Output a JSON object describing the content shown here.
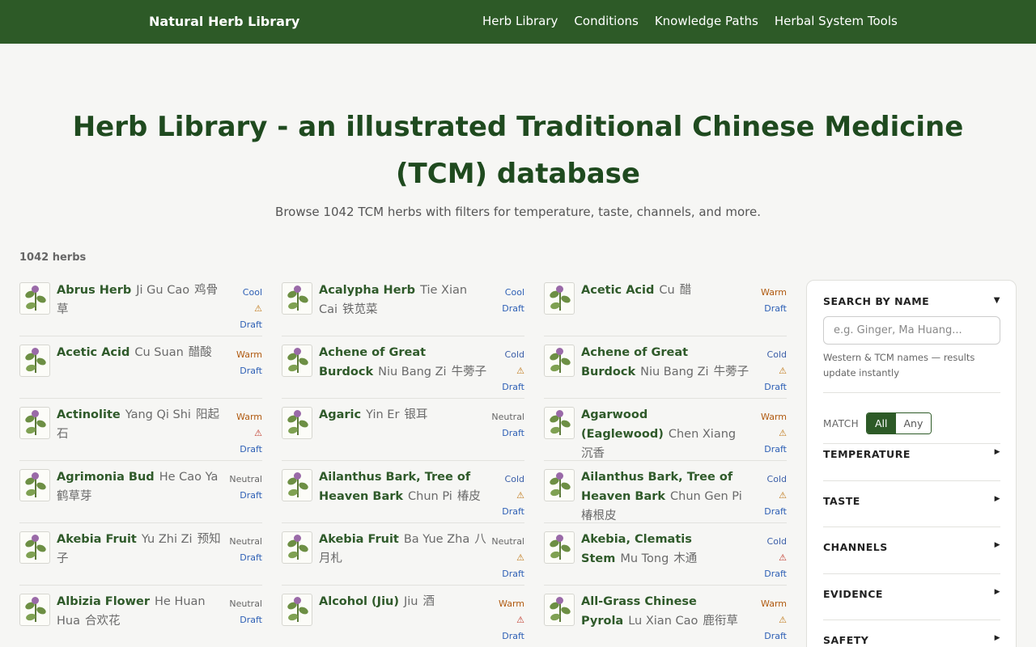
{
  "header": {
    "brand": "Natural Herb Library",
    "nav": [
      "Herb Library",
      "Conditions",
      "Knowledge Paths",
      "Herbal System Tools"
    ]
  },
  "hero": {
    "title": "Herb Library - an illustrated Traditional Chinese Medicine (TCM) database",
    "subtitle": "Browse 1042 TCM herbs with filters for temperature, taste, channels, and more."
  },
  "count_label": "1042 herbs",
  "herbs": [
    {
      "en": "Abrus Herb",
      "pinyin": "Ji Gu Cao",
      "zh": "鸡骨草",
      "temp": "Cool",
      "temp_class": "cool",
      "warning": "⚠",
      "warn_class": "warn",
      "status": "Draft"
    },
    {
      "en": "Acalypha Herb",
      "pinyin": "Tie Xian Cai",
      "zh": "铁苋菜",
      "temp": "Cool",
      "temp_class": "cool",
      "warning": "",
      "warn_class": "warn",
      "status": "Draft"
    },
    {
      "en": "Acetic Acid",
      "pinyin": "Cu",
      "zh": "醋",
      "temp": "Warm",
      "temp_class": "warm",
      "warning": "",
      "warn_class": "warn",
      "status": "Draft"
    },
    {
      "en": "Acetic Acid",
      "pinyin": "Cu Suan",
      "zh": "醋酸",
      "temp": "Warm",
      "temp_class": "warm",
      "warning": "",
      "warn_class": "warn",
      "status": "Draft"
    },
    {
      "en": "Achene of Great Burdock",
      "pinyin": "Niu Bang Zi",
      "zh": "牛蒡子",
      "temp": "Cold",
      "temp_class": "cold",
      "warning": "⚠",
      "warn_class": "warn",
      "status": "Draft"
    },
    {
      "en": "Achene of Great Burdock",
      "pinyin": "Niu Bang Zi",
      "zh": "牛蒡子",
      "temp": "Cold",
      "temp_class": "cold",
      "warning": "⚠",
      "warn_class": "warn",
      "status": "Draft"
    },
    {
      "en": "Actinolite",
      "pinyin": "Yang Qi Shi",
      "zh": "阳起石",
      "temp": "Warm",
      "temp_class": "warm",
      "warning": "⚠",
      "warn_class": "warn red",
      "status": "Draft"
    },
    {
      "en": "Agaric",
      "pinyin": "Yin Er",
      "zh": "银耳",
      "temp": "Neutral",
      "temp_class": "neutral",
      "warning": "",
      "warn_class": "warn",
      "status": "Draft"
    },
    {
      "en": "Agarwood (Eaglewood)",
      "pinyin": "Chen Xiang",
      "zh": "沉香",
      "temp": "Warm",
      "temp_class": "warm",
      "warning": "⚠",
      "warn_class": "warn",
      "status": "Draft"
    },
    {
      "en": "Agrimonia Bud",
      "pinyin": "He Cao Ya",
      "zh": "鹤草芽",
      "temp": "Neutral",
      "temp_class": "neutral",
      "warning": "",
      "warn_class": "warn",
      "status": "Draft"
    },
    {
      "en": "Ailanthus Bark, Tree of Heaven Bark",
      "pinyin": "Chun Pi",
      "zh": "椿皮",
      "temp": "Cold",
      "temp_class": "cold",
      "warning": "⚠",
      "warn_class": "warn",
      "status": "Draft"
    },
    {
      "en": "Ailanthus Bark, Tree of Heaven Bark",
      "pinyin": "Chun Gen Pi",
      "zh": "椿根皮",
      "temp": "Cold",
      "temp_class": "cold",
      "warning": "⚠",
      "warn_class": "warn",
      "status": "Draft"
    },
    {
      "en": "Akebia Fruit",
      "pinyin": "Yu Zhi Zi",
      "zh": "预知子",
      "temp": "Neutral",
      "temp_class": "neutral",
      "warning": "",
      "warn_class": "warn",
      "status": "Draft"
    },
    {
      "en": "Akebia Fruit",
      "pinyin": "Ba Yue Zha",
      "zh": "八月札",
      "temp": "Neutral",
      "temp_class": "neutral",
      "warning": "⚠",
      "warn_class": "warn",
      "status": "Draft"
    },
    {
      "en": "Akebia, Clematis Stem",
      "pinyin": "Mu Tong",
      "zh": "木通",
      "temp": "Cold",
      "temp_class": "cold",
      "warning": "⚠",
      "warn_class": "warn red",
      "status": "Draft"
    },
    {
      "en": "Albizia Flower",
      "pinyin": "He Huan Hua",
      "zh": "合欢花",
      "temp": "Neutral",
      "temp_class": "neutral",
      "warning": "",
      "warn_class": "warn",
      "status": "Draft"
    },
    {
      "en": "Alcohol (Jiu)",
      "pinyin": "Jiu",
      "zh": "酒",
      "temp": "Warm",
      "temp_class": "warm",
      "warning": "⚠",
      "warn_class": "warn red",
      "status": "Draft"
    },
    {
      "en": "All-Grass Chinese Pyrola",
      "pinyin": "Lu Xian Cao",
      "zh": "鹿衔草",
      "temp": "Warm",
      "temp_class": "warm",
      "warning": "⚠",
      "warn_class": "warn",
      "status": "Draft"
    }
  ],
  "sidebar": {
    "search_heading": "SEARCH BY NAME",
    "search_toggle": "▼",
    "search_placeholder": "e.g. Ginger, Ma Huang...",
    "search_hint": "Western & TCM names — results update instantly",
    "match_label": "MATCH",
    "match_all": "All",
    "match_any": "Any",
    "sections": [
      "TEMPERATURE",
      "TASTE",
      "CHANNELS",
      "EVIDENCE",
      "SAFETY"
    ],
    "section_arrow": "▶"
  },
  "colors": {
    "brand_green": "#2d5a27",
    "warm": "#b05a10",
    "cool": "#2d5fb5"
  }
}
